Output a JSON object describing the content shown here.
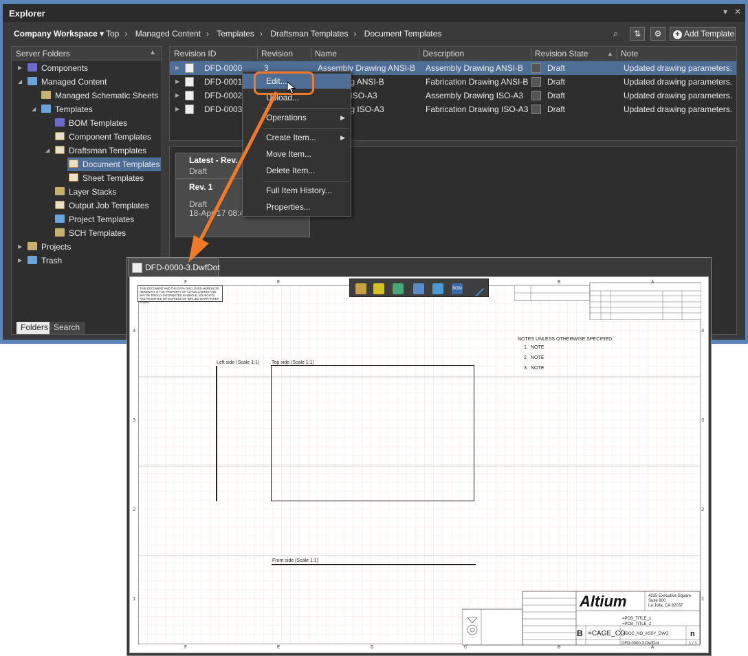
{
  "window": {
    "title": "Explorer"
  },
  "topbar": {
    "workspace": "Company Workspace",
    "breadcrumbs": [
      "Top",
      "Managed Content",
      "Templates",
      "Draftsman Templates",
      "Document Templates"
    ],
    "add_button": "Add Template"
  },
  "folders": {
    "header": "Server Folders",
    "items": [
      {
        "label": "Components",
        "icon": "component-icon"
      },
      {
        "label": "Managed Content",
        "icon": "folder-icon"
      },
      {
        "label": "Managed Schematic Sheets",
        "icon": "schematic-sheets-icon"
      },
      {
        "label": "Templates",
        "icon": "folder-icon"
      },
      {
        "label": "BOM Templates",
        "icon": "bom-template-icon"
      },
      {
        "label": "Component Templates",
        "icon": "component-template-icon"
      },
      {
        "label": "Draftsman Templates",
        "icon": "draftsman-template-icon"
      },
      {
        "label": "Document Templates",
        "icon": "document-template-icon"
      },
      {
        "label": "Sheet Templates",
        "icon": "sheet-template-icon"
      },
      {
        "label": "Layer Stacks",
        "icon": "layer-stack-icon"
      },
      {
        "label": "Output Job Templates",
        "icon": "output-job-icon"
      },
      {
        "label": "Project Templates",
        "icon": "project-template-icon"
      },
      {
        "label": "SCH Templates",
        "icon": "sch-template-icon"
      },
      {
        "label": "Projects",
        "icon": "projects-icon"
      },
      {
        "label": "Trash",
        "icon": "trash-folder-icon"
      }
    ],
    "selected": "Document Templates",
    "tabs": [
      "Folders",
      "Search"
    ]
  },
  "grid": {
    "columns": [
      "Revision ID",
      "Revision",
      "Name",
      "Description",
      "Revision State",
      "Note"
    ],
    "rows": [
      {
        "id": "DFD-0000",
        "rev": "3",
        "name": "Assembly Drawing ANSI-B",
        "desc": "Assembly Drawing ANSI-B",
        "state": "Draft",
        "note": "Updated drawing parameters."
      },
      {
        "id": "DFD-0001",
        "rev": "",
        "name": "n Drawing ANSI-B",
        "desc": "Fabrication Drawing ANSI-B",
        "state": "Draft",
        "note": "Updated drawing parameters."
      },
      {
        "id": "DFD-0002",
        "rev": "",
        "name": "Drawing ISO-A3",
        "desc": "Assembly Drawing ISO-A3",
        "state": "Draft",
        "note": "Updated drawing parameters."
      },
      {
        "id": "DFD-0003",
        "rev": "",
        "name": "n Drawing ISO-A3",
        "desc": "Fabrication Drawing ISO-A3",
        "state": "Draft",
        "note": "Updated drawing parameters."
      }
    ]
  },
  "revisions": [
    {
      "title": "Latest - Rev.  1",
      "status": "Draft"
    },
    {
      "title": "Rev. 1",
      "status": "Draft",
      "date": "18-Apr-17 08:44"
    }
  ],
  "context_menu": {
    "items": [
      "Edit...",
      "Upload...",
      "Operations",
      "Create Item...",
      "Move Item...",
      "Delete Item...",
      "Full Item History...",
      "Properties..."
    ]
  },
  "document": {
    "tab": "DFD-0000-3.DwfDot",
    "zones_top": [
      "F",
      "E",
      "B",
      "A"
    ],
    "zones_bottom": [
      "F",
      "E",
      "D",
      "C",
      "B",
      "A"
    ],
    "rows_side": [
      "4",
      "3",
      "2",
      "1"
    ],
    "disclaimer": "THIS DOCUMENT AND THE DATA DISCLOSED HEREIN OR HEREWITH IS THE PROPERTY OF ALTIUM LIMITED AND MAY BE FREELY DISTRIBUTED IN WHOLE, NO RIGHTS ARE RESERVED OR EXPRESS OR IMPLIED WARRANTIES GIVEN.",
    "notes_heading": "NOTES UNLESS OTHERWISE SPECIFIED:",
    "notes": [
      "NOTE",
      "NOTE",
      "NOTE"
    ],
    "view_left": "Left side (Scale 1:1)",
    "view_top": "Top side (Scale 1:1)",
    "view_front": "Front side (Scale 1:1)",
    "title_block": {
      "logo": "Altium",
      "address": [
        "4225 Executive Square",
        "Suite 800",
        "La Jolla, CA 92037"
      ],
      "title1": "=PCB_TITLE_1",
      "title2": "=PCB_TITLE_2",
      "size": "B",
      "cage": "=CAGE_CO",
      "dwg_no": "=DOC_NO_ASSY_DWG",
      "rev": "n",
      "file": "DFD-0000-3.DwfDot",
      "sheet": "1 / 1"
    }
  }
}
